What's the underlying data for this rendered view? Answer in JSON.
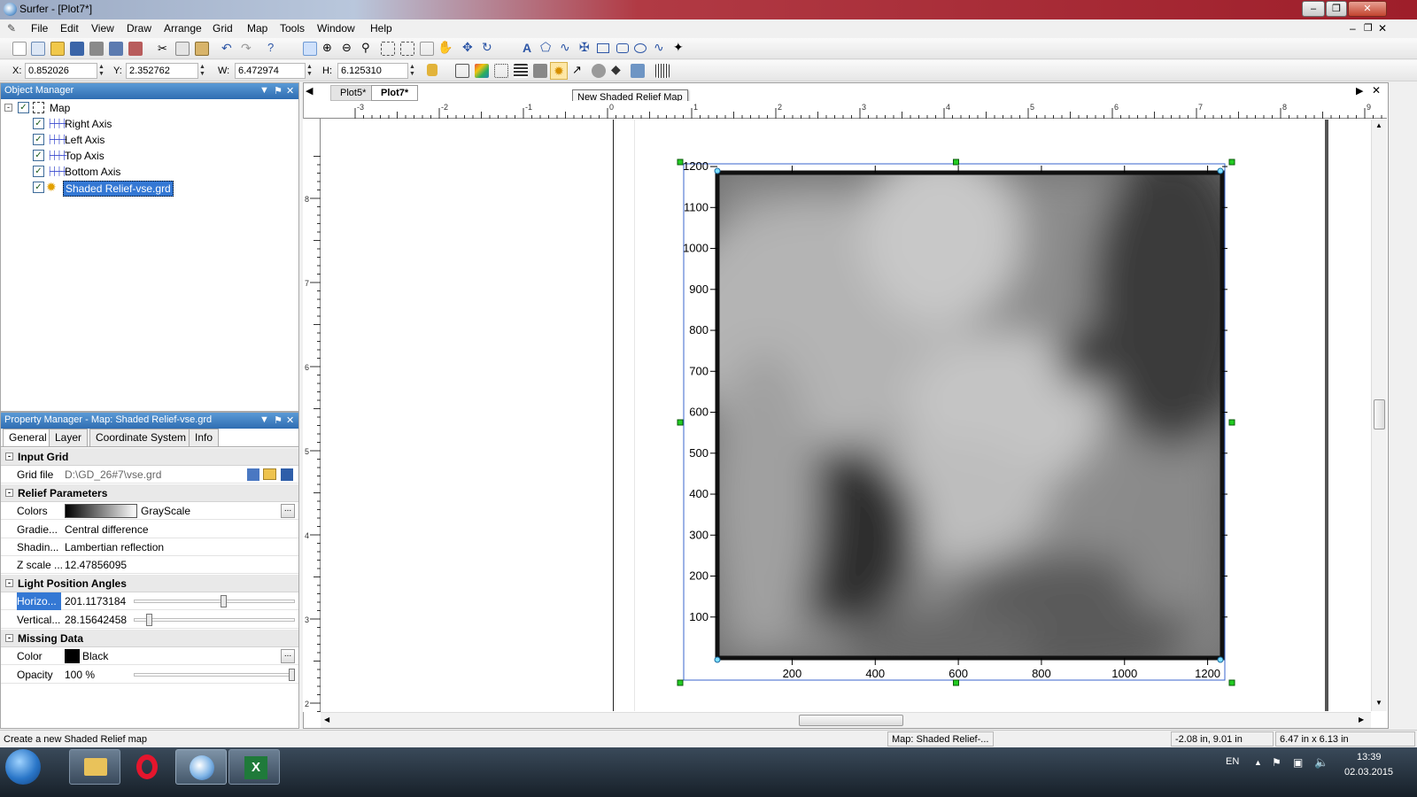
{
  "window": {
    "title": "Surfer - [Plot7*]"
  },
  "menu": [
    "File",
    "Edit",
    "View",
    "Draw",
    "Arrange",
    "Grid",
    "Map",
    "Tools",
    "Window",
    "Help"
  ],
  "coords": {
    "x_label": "X:",
    "x_value": "0.852026",
    "y_label": "Y:",
    "y_value": "2.352762",
    "w_label": "W:",
    "w_value": "6.472974",
    "h_label": "H:",
    "h_value": "6.125310"
  },
  "object_manager": {
    "title": "Object Manager",
    "root": "Map",
    "items": [
      "Right Axis",
      "Left Axis",
      "Top Axis",
      "Bottom Axis",
      "Shaded Relief-vse.grd"
    ]
  },
  "property_manager": {
    "title": "Property Manager - Map: Shaded Relief-vse.grd",
    "tabs": [
      "General",
      "Layer",
      "Coordinate System",
      "Info"
    ],
    "sections": {
      "input_grid": "Input Grid",
      "relief": "Relief Parameters",
      "light": "Light Position Angles",
      "missing": "Missing Data"
    },
    "rows": {
      "grid_file_k": "Grid file",
      "grid_file_v": "D:\\GD_26#7\\vse.grd",
      "colors_k": "Colors",
      "colors_v": "GrayScale",
      "gradient_k": "Gradie...",
      "gradient_v": "Central difference",
      "shading_k": "Shadin...",
      "shading_v": "Lambertian reflection",
      "zscale_k": "Z scale ...",
      "zscale_v": "12.47856095",
      "horiz_k": "Horizo...",
      "horiz_v": "201.1173184",
      "vert_k": "Vertical...",
      "vert_v": "28.15642458",
      "color_k": "Color",
      "color_v": "Black",
      "opacity_k": "Opacity",
      "opacity_v": "100 %"
    },
    "slider_levels": {
      "horizontal": 0.56,
      "vertical": 0.08,
      "opacity": 1.0
    }
  },
  "doc_tabs": [
    "Plot5*",
    "Plot7*"
  ],
  "tooltip": "New Shaded Relief Map",
  "ruler_h": [
    "-3",
    "-2",
    "-1",
    "0",
    "1",
    "2",
    "3",
    "4",
    "5",
    "6",
    "7",
    "8",
    "9"
  ],
  "ruler_v": [
    "8",
    "7",
    "6",
    "5",
    "4",
    "3",
    "2"
  ],
  "map": {
    "y_ticks": [
      "1200",
      "1100",
      "1000",
      "900",
      "800",
      "700",
      "600",
      "500",
      "400",
      "300",
      "200",
      "100"
    ],
    "x_ticks": [
      "200",
      "400",
      "600",
      "800",
      "1000",
      "1200"
    ]
  },
  "status": {
    "message": "Create a new Shaded Relief map",
    "selection": "Map: Shaded Relief-...",
    "position": "-2.08 in, 9.01 in",
    "size": "6.47 in x 6.13 in"
  },
  "taskbar": {
    "lang": "EN",
    "time": "13:39",
    "date": "02.03.2015"
  }
}
